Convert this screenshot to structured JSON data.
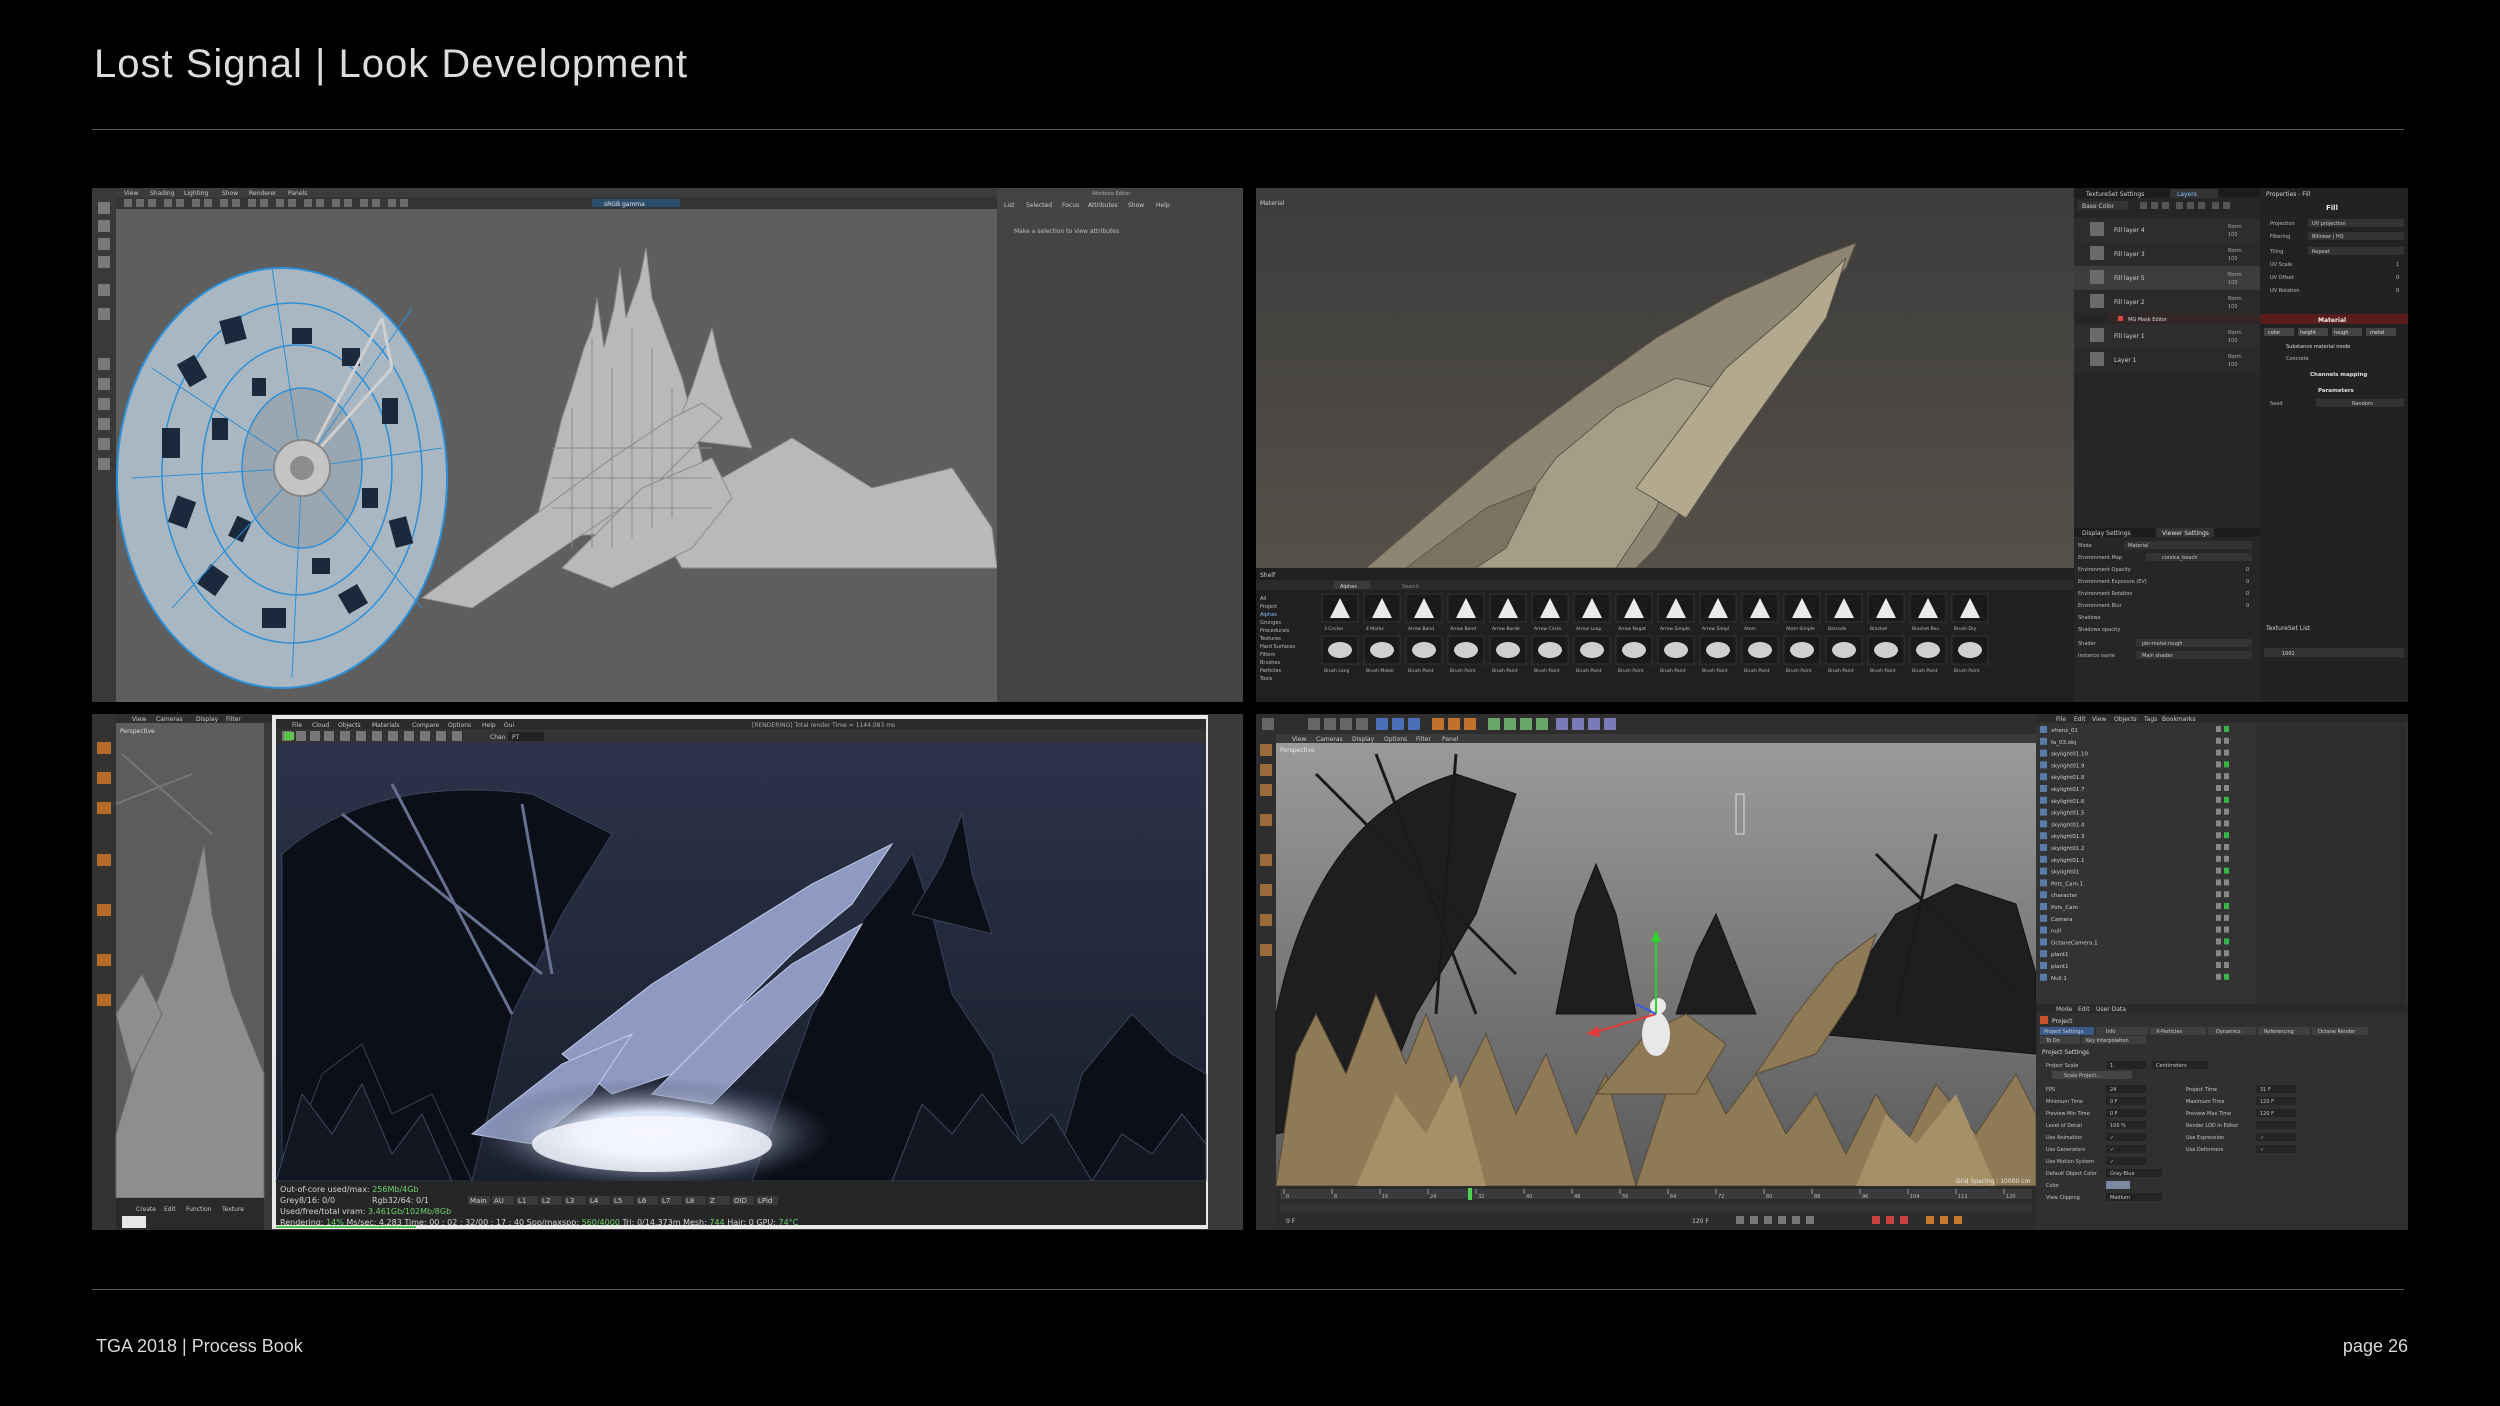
{
  "header": {
    "title": "Lost Signal | Look Development"
  },
  "footer": {
    "left": "TGA 2018  |  Process Book",
    "right": "page 26"
  },
  "panels": {
    "maya": {
      "menu": [
        "View",
        "Shading",
        "Lighting",
        "Show",
        "Renderer",
        "Panels"
      ],
      "colorspace": "sRGB gamma",
      "attr_tabs": [
        "List",
        "Selected",
        "Focus",
        "Attributes",
        "Show",
        "Help"
      ],
      "attr_title": "Attribute Editor",
      "attr_hint": "Make a selection to view attributes"
    },
    "painter": {
      "viewport_label": "Material",
      "layers_tabs": [
        "TextureSet Settings",
        "Layers"
      ],
      "blend_mode": "Base Color",
      "layers": [
        {
          "name": "Fill layer 4",
          "blend": "Norm",
          "opacity": "100"
        },
        {
          "name": "Fill layer 3",
          "blend": "Norm",
          "opacity": "100"
        },
        {
          "name": "Fill layer 5",
          "blend": "Norm",
          "opacity": "100"
        },
        {
          "name": "Fill layer 2",
          "blend": "Norm",
          "opacity": "100"
        },
        {
          "name": "Fill layer 1",
          "blend": "Norm",
          "opacity": "100"
        },
        {
          "name": "Layer 1",
          "blend": "Norm",
          "opacity": "100"
        }
      ],
      "mask_editor": "MG Mask Editor",
      "props_title": "Properties - Fill",
      "props_fill": "Fill",
      "props_rows": [
        {
          "label": "Projection",
          "value": "UV projection"
        },
        {
          "label": "Filtering",
          "value": "Bilinear | HQ"
        },
        {
          "label": "Tiling",
          "value": "Repeat"
        },
        {
          "label": "UV Scale",
          "value": "1"
        },
        {
          "label": "UV Offset",
          "value": "0"
        },
        {
          "label": "UV Rotation",
          "value": "0"
        }
      ],
      "material_title": "Material",
      "channels": [
        "color",
        "height",
        "rough",
        "metal"
      ],
      "substance_mode": "Substance material mode",
      "concrete": "Concrete",
      "channels_mapping": "Channels mapping",
      "parameters": "Parameters",
      "seed_label": "Seed",
      "seed_value": "Random",
      "shelf_title": "Shelf",
      "shelf_categories": [
        "All",
        "Project",
        "Alphas",
        "Grunges",
        "Procedurals",
        "Textures",
        "Hard Surfaces",
        "Filters",
        "Brushes",
        "Particles",
        "Tools"
      ],
      "shelf_search_tab": "Alphas",
      "shelf_search_placeholder": "Search",
      "shelf_row1_labels": [
        "3 Circles",
        "4 Marks",
        "Arrow Band",
        "Arrow Bend",
        "Arrow Borde",
        "Arrow Circle",
        "Arrow Loop",
        "Arrow Negat",
        "Arrow Simple",
        "Arrow Simpl",
        "Atom",
        "Atom Simple",
        "Barcode",
        "Bracket",
        "Bracket Bev",
        "Brush Dry"
      ],
      "shelf_row2_labels": [
        "Brush Long",
        "Brush Maker",
        "Brush Paint",
        "Brush Paint",
        "Brush Paint",
        "Brush Paint",
        "Brush Paint",
        "Brush Paint",
        "Brush Paint",
        "Brush Paint",
        "Brush Paint",
        "Brush Paint",
        "Brush Paint",
        "Brush Paint",
        "Brush Paint",
        "Brush Paint"
      ],
      "display_tabs": [
        "Display Settings",
        "Viewer Settings"
      ],
      "display_rows": [
        {
          "label": "Mode",
          "value": "Material"
        },
        {
          "label": "Environment Map",
          "value": "corsica_beach"
        },
        {
          "label": "Environment Opacity",
          "value": "0"
        },
        {
          "label": "Environment Exposure (EV)",
          "value": "0"
        },
        {
          "label": "Environment Rotation",
          "value": "0"
        },
        {
          "label": "Environment Blur",
          "value": "0"
        },
        {
          "label": "Shadows",
          "value": ""
        },
        {
          "label": "Shadows opacity",
          "value": ""
        },
        {
          "label": "Shader",
          "value": "pbr-metal-rough"
        },
        {
          "label": "Instance name",
          "value": "Main shader"
        }
      ],
      "textureset_list": "TextureSet List",
      "textureset_item": "1001"
    },
    "octane": {
      "menu": [
        "View",
        "Cameras",
        "Display",
        "Filter"
      ],
      "viewport_label": "Perspective",
      "lv_menu": [
        "File",
        "Cloud",
        "Objects",
        "Materials",
        "Compare",
        "Options",
        "Help",
        "Gui"
      ],
      "lv_title": "[RENDERING] Total render Time = 1144.083 ms",
      "chan_label": "Chan",
      "chan_value": "PT",
      "stats": {
        "out_of_core": "Out-of-core used/max:",
        "out_of_core_val": "256Mb/4Gb",
        "grey": "Grey8/16: 0/0",
        "rgb": "Rgb32/64: 0/1",
        "vram": "Used/free/total vram:",
        "vram_val": "3.461Gb/102Mb/8Gb",
        "passes": [
          "Main",
          "AU",
          "L1",
          "L2",
          "L3",
          "L4",
          "L5",
          "L6",
          "L7",
          "L8",
          "Z",
          "OID",
          "LPid"
        ],
        "rendering_label": "Rendering:",
        "rendering_val": "14%",
        "ms_label": "Ms/sec:",
        "ms_val": "4.283",
        "time_label": "Time:",
        "time_val": "00 : 02 : 32/00 : 17 : 40",
        "spp_label": "Spp/maxspp:",
        "spp_val": "560/4000",
        "tri_label": "Tri:",
        "tri_val": "0/14.373m",
        "mesh_label": "Mesh:",
        "mesh_val": "744",
        "hair_label": "Hair:",
        "hair_val": "0",
        "gpu_label": "GPU:",
        "gpu_val": "74°C"
      },
      "bottom_menu": [
        "Create",
        "Edit",
        "Function",
        "Texture"
      ]
    },
    "c4d": {
      "menu": [
        "View",
        "Cameras",
        "Display",
        "Options",
        "Filter",
        "Panel"
      ],
      "viewport_label": "Perspective",
      "grid_spacing": "Grid Spacing : 10000 cm",
      "om_menu": [
        "File",
        "Edit",
        "View",
        "Objects",
        "Tags",
        "Bookmarks"
      ],
      "objects": [
        "xfrenz_01",
        "fa_03.obj",
        "skylight01.10",
        "skylight01.9",
        "skylight01.8",
        "skylight01.7",
        "skylight01.6",
        "skylight01.5",
        "skylight01.4",
        "skylight01.3",
        "skylight01.2",
        "skylight01.1",
        "skylight01",
        "Pots_Cam.1",
        "character",
        "Pots_Cam",
        "Camera",
        "null",
        "OctaneCamera.1",
        "plant1",
        "plant1",
        "Null.1"
      ],
      "attr_menu": [
        "Mode",
        "Edit",
        "User Data"
      ],
      "attr_object": "Project",
      "attr_tabs": [
        "Project Settings",
        "Info",
        "X-Particles",
        "Dynamics",
        "Referencing",
        "Octane Render",
        "To Do",
        "Key Interpolation"
      ],
      "attr_section": "Project Settings",
      "project_scale_label": "Project Scale",
      "project_scale_value": "1",
      "project_scale_unit": "Centimeters",
      "scale_project_button": "Scale Project...",
      "settings_left": [
        {
          "label": "FPS",
          "value": "24"
        },
        {
          "label": "Minimum Time",
          "value": "0 F"
        },
        {
          "label": "Preview Min Time",
          "value": "0 F"
        },
        {
          "label": "Level of Detail",
          "value": "100 %"
        },
        {
          "label": "Use Animation",
          "value": "✓"
        },
        {
          "label": "Use Generators",
          "value": "✓"
        },
        {
          "label": "Use Motion System",
          "value": "✓"
        }
      ],
      "settings_right": [
        {
          "label": "Project Time",
          "value": "31 F"
        },
        {
          "label": "Maximum Time",
          "value": "120 F"
        },
        {
          "label": "Preview Max Time",
          "value": "120 F"
        },
        {
          "label": "Render LOD in Editor",
          "value": ""
        },
        {
          "label": "Use Expression",
          "value": "✓"
        },
        {
          "label": "Use Deformers",
          "value": "✓"
        }
      ],
      "default_color_label": "Default Object Color",
      "default_color_value": "Gray-Blue",
      "color_label": "Color",
      "view_clipping_label": "View Clipping",
      "view_clipping_value": "Medium",
      "timeline_ticks": [
        "0",
        "8",
        "16",
        "24",
        "32",
        "40",
        "48",
        "56",
        "64",
        "72",
        "80",
        "88",
        "96",
        "104",
        "112",
        "120"
      ],
      "current_frame": "0 F",
      "end_frame": "120 F"
    }
  }
}
